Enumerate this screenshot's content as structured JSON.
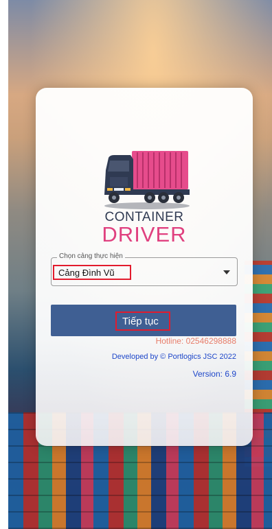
{
  "brand": {
    "line1": "CONTAINER",
    "line2": "DRIVER"
  },
  "port_select": {
    "label": "Chọn cảng thực hiện",
    "value": "Cảng Đình Vũ"
  },
  "continue_button": {
    "label": "Tiếp tục"
  },
  "footer": {
    "hotline": "Hotline: 02546298888",
    "developed_by": "Developed by © Portlogics JSC 2022",
    "version": "Version: 6.9"
  },
  "colors": {
    "brand_dark": "#2f3a52",
    "brand_pink": "#e0407f",
    "button_bg": "#3f5f93",
    "highlight_red": "#e21b2d",
    "link_blue": "#1d46c9",
    "hotline_orange": "#e77d6a"
  }
}
